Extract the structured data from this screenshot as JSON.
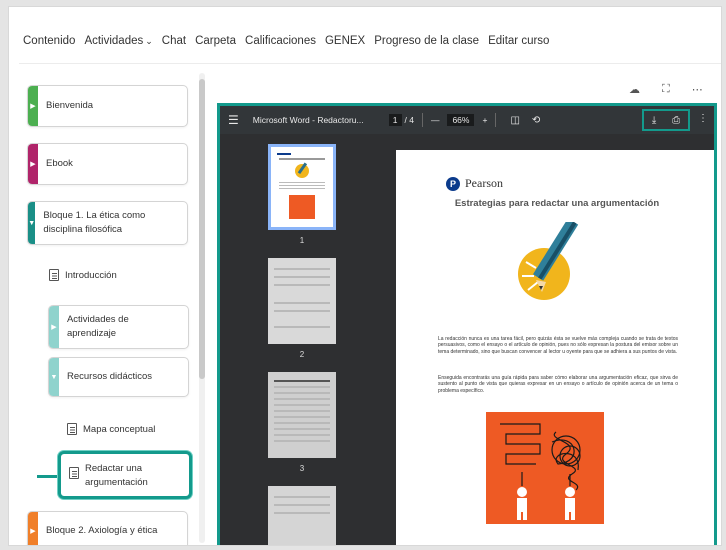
{
  "nav": {
    "items": [
      "Contenido",
      "Actividades",
      "Chat",
      "Carpeta",
      "Calificaciones",
      "GENEX",
      "Progreso de la clase",
      "Editar curso"
    ]
  },
  "sidebar": {
    "modules": [
      {
        "label": "Bienvenida",
        "color": "#4caf50"
      },
      {
        "label": "Ebook",
        "color": "#b0246a"
      },
      {
        "label": "Bloque 1. La ética como disciplina filosófica",
        "color": "#1a8f87"
      },
      {
        "label": "Actividades de aprendizaje",
        "color": "#8fd3cd"
      },
      {
        "label": "Recursos didácticos",
        "color": "#8fd3cd"
      },
      {
        "label": "Bloque 2. Axiología y ética",
        "color": "#f07f29"
      }
    ],
    "topics": [
      "Introducción",
      "Mapa conceptual",
      "Redactar una argumentación"
    ]
  },
  "viewer": {
    "file_name": "Microsoft Word - Redactoru...",
    "page_current": "1",
    "page_total": "/ 4",
    "zoom": "66%",
    "thumb_numbers": [
      "1",
      "2",
      "3"
    ],
    "doc": {
      "brand": "Pearson",
      "title": "Estrategias para redactar una argumentación",
      "para1": "La redacción nunca es una tarea fácil, pero quizás ésta se vuelve más compleja cuando se trata de textos persuasivos, como el ensayo o el artículo de opinión, pues no sólo expresan la postura del emisor sobre un tema determinado, sino que buscan convencer al lector u oyente para que se adhiera a sus puntos de vista.",
      "para2": "Enseguida encontrarás una guía rápida para saber cómo elaborar una argumentación eficaz, que sirva de sustento al punto de vista que quieras expresar en un ensayo o artículo de opinión acerca de un tema o problema específico."
    }
  },
  "icons": {
    "highlight": "#139a8c"
  }
}
